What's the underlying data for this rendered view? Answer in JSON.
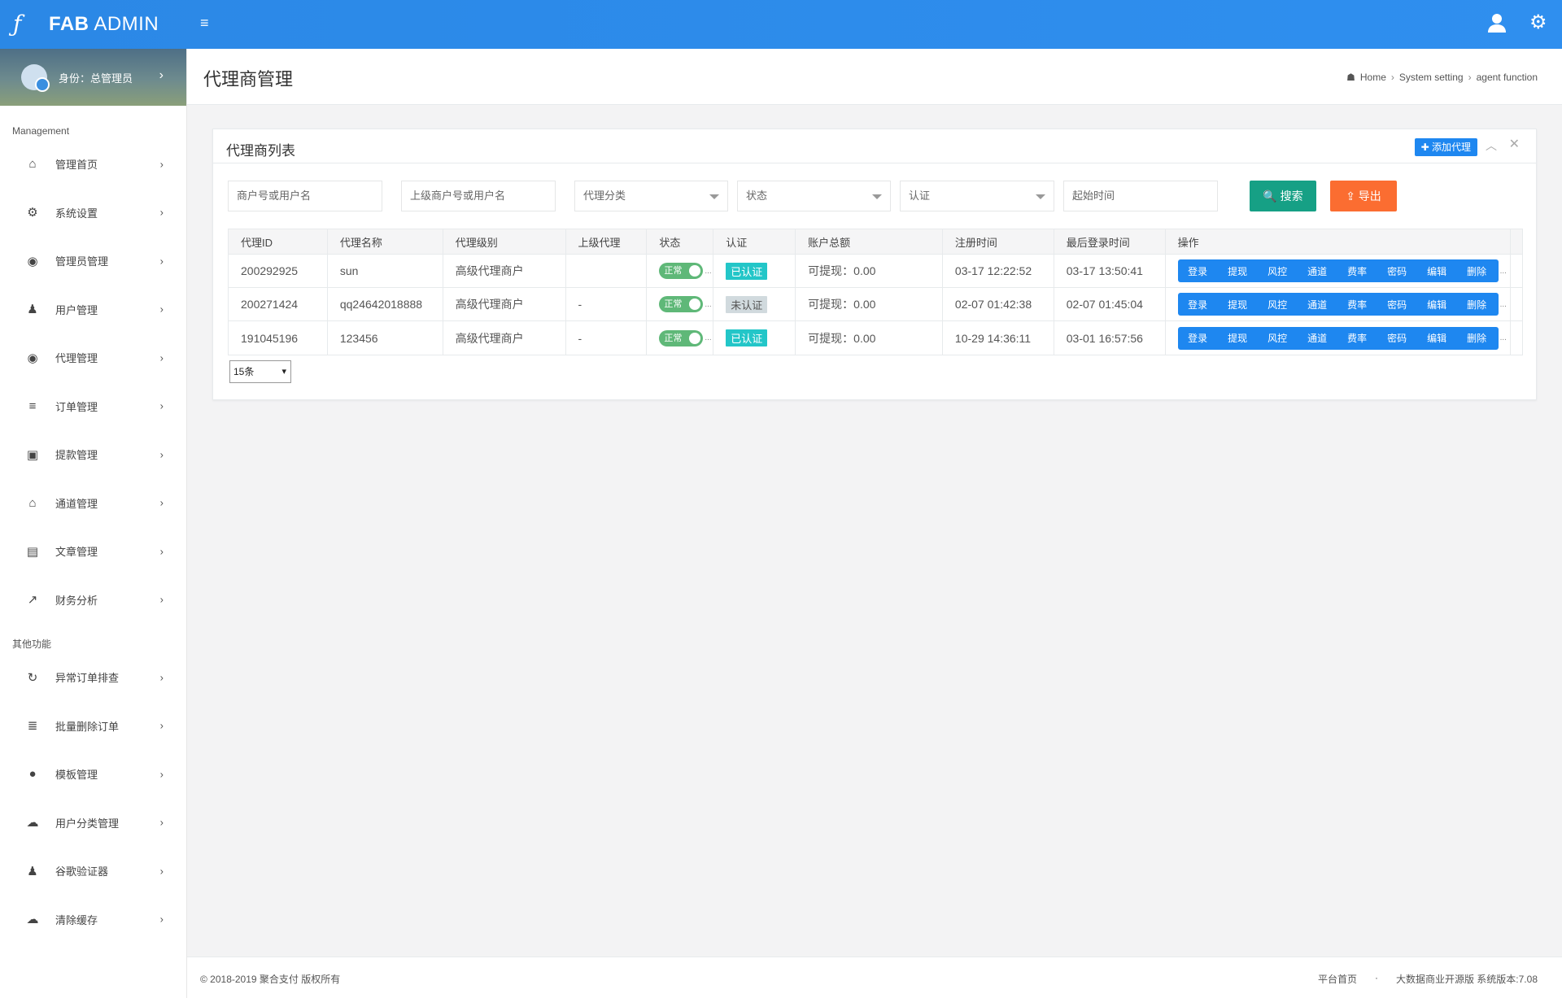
{
  "brand": {
    "logo": "ƒ",
    "bold": "FAB",
    "rest": " ADMIN"
  },
  "top": {
    "menu_icon": "≡",
    "user_icon": "user-icon",
    "gear_icon": "gear-icon"
  },
  "profile": {
    "label": "身份：总管理员",
    "arrow": "›"
  },
  "sidebar": {
    "section1": "Management",
    "items1": [
      {
        "label": "管理首页",
        "icon": "⌂"
      },
      {
        "label": "系统设置",
        "icon": "⚙"
      },
      {
        "label": "管理员管理",
        "icon": "◉"
      },
      {
        "label": "用户管理",
        "icon": "♟"
      },
      {
        "label": "代理管理",
        "icon": "◉"
      },
      {
        "label": "订单管理",
        "icon": "≡"
      },
      {
        "label": "提款管理",
        "icon": "▣"
      },
      {
        "label": "通道管理",
        "icon": "⌂"
      },
      {
        "label": "文章管理",
        "icon": "▤"
      },
      {
        "label": "财务分析",
        "icon": "↗"
      }
    ],
    "section2": "其他功能",
    "items2": [
      {
        "label": "异常订单排查",
        "icon": "↻"
      },
      {
        "label": "批量删除订单",
        "icon": "≣"
      },
      {
        "label": "模板管理",
        "icon": "●"
      },
      {
        "label": "用户分类管理",
        "icon": "☁"
      },
      {
        "label": "谷歌验证器",
        "icon": "♟"
      },
      {
        "label": "清除缓存",
        "icon": "☁"
      }
    ],
    "arrow": "›"
  },
  "page": {
    "title": "代理商管理"
  },
  "breadcrumb": {
    "home": "Home",
    "level2": "System setting",
    "level3": "agent function",
    "sep": "›"
  },
  "panel": {
    "title": "代理商列表",
    "add_button": "✚ 添加代理",
    "collapse": "︿",
    "close": "✕"
  },
  "filters": {
    "merchant": "商户号或用户名",
    "parent": "上级商户号或用户名",
    "category": "代理分类",
    "status": "状态",
    "auth": "认证",
    "start_time": "起始时间",
    "search_button": "🔍 搜索",
    "export_button": "⇪ 导出"
  },
  "table": {
    "headers": [
      "代理ID",
      "代理名称",
      "代理级别",
      "上级代理",
      "状态",
      "认证",
      "账户总额",
      "注册时间",
      "最后登录时间",
      "操作"
    ],
    "ops": [
      "登录",
      "提现",
      "风控",
      "通道",
      "费率",
      "密码",
      "编辑",
      "删除"
    ],
    "rows": [
      {
        "id": "200292925",
        "name": "sun",
        "level": "高级代理商户",
        "parent": "",
        "status": "正常",
        "auth": "已认证",
        "auth_ok": true,
        "balance": "可提现：0.00",
        "reg": "03-17 12:22:52",
        "last": "03-17 13:50:41"
      },
      {
        "id": "200271424",
        "name": "qq24642018888",
        "level": "高级代理商户",
        "parent": "-",
        "status": "正常",
        "auth": "未认证",
        "auth_ok": false,
        "balance": "可提现：0.00",
        "reg": "02-07 01:42:38",
        "last": "02-07 01:45:04"
      },
      {
        "id": "191045196",
        "name": "123456",
        "level": "高级代理商户",
        "parent": "-",
        "status": "正常",
        "auth": "已认证",
        "auth_ok": true,
        "balance": "可提现：0.00",
        "reg": "10-29 14:36:11",
        "last": "03-01 16:57:56"
      }
    ],
    "more": "..."
  },
  "pagesize": "15条",
  "footer": {
    "copyright": "© 2018-2019 聚合支付 版权所有",
    "link1": "平台首页",
    "sep": "·",
    "link2": "大数据商业开源版 系统版本:7.08"
  },
  "colors": {
    "topbar": "#2d8cf0",
    "search": "#16a085",
    "export": "#fb6d31",
    "toggle": "#5fb878",
    "auth_ok": "#23c6c8"
  }
}
